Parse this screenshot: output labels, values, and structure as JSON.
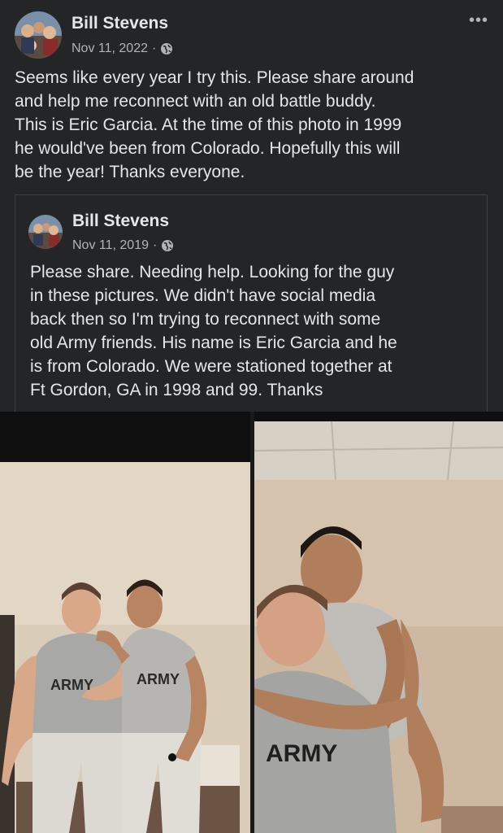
{
  "post": {
    "author": "Bill Stevens",
    "date": "Nov 11, 2022",
    "separator": "·",
    "more_label": "•••",
    "text_lines": [
      "Seems like every year I try this.  Please share around",
      "and help me reconnect with an old battle buddy.",
      "This is Eric Garcia.  At the time of this photo in 1999",
      "he would've been from Colorado.  Hopefully this will",
      "be the year!  Thanks everyone."
    ]
  },
  "shared_post": {
    "author": "Bill Stevens",
    "date": "Nov 11, 2019",
    "separator": "·",
    "text_lines": [
      "Please share.  Needing help.  Looking for the guy",
      "in these pictures.  We didn't have social media",
      "back then so I'm trying to reconnect with some",
      "old Army friends.  His name is Eric Garcia and he",
      "is from Colorado.  We were stationed together at",
      "Ft Gordon, GA in 1998 and 99.  Thanks"
    ]
  },
  "photos": {
    "left_shirt_1": "ARMY",
    "left_shirt_2": "ARMY",
    "right_shirt": "ARMY"
  },
  "colors": {
    "background": "#242526",
    "text": "#e4e6eb",
    "secondary_text": "#b0b3b8",
    "border": "#3e4042"
  },
  "icons": [
    "avatar-photo",
    "globe-icon",
    "more-options-icon"
  ]
}
